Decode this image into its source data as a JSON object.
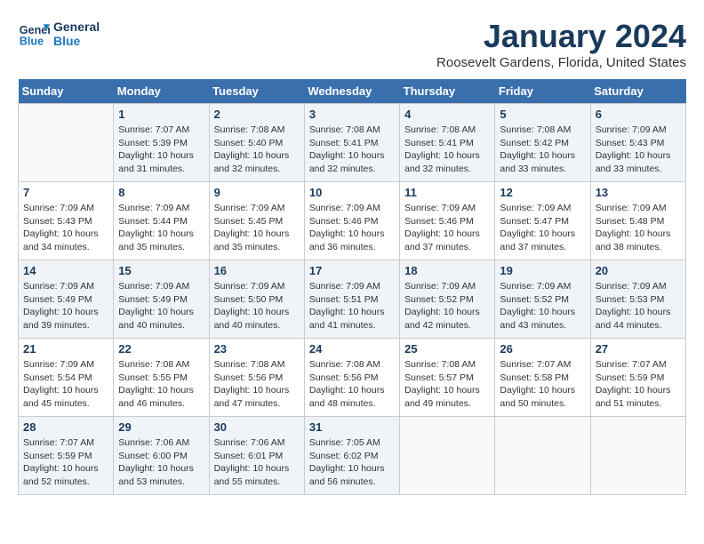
{
  "logo": {
    "line1": "General",
    "line2": "Blue"
  },
  "title": "January 2024",
  "location": "Roosevelt Gardens, Florida, United States",
  "weekdays": [
    "Sunday",
    "Monday",
    "Tuesday",
    "Wednesday",
    "Thursday",
    "Friday",
    "Saturday"
  ],
  "weeks": [
    [
      {
        "day": "",
        "info": ""
      },
      {
        "day": "1",
        "info": "Sunrise: 7:07 AM\nSunset: 5:39 PM\nDaylight: 10 hours\nand 31 minutes."
      },
      {
        "day": "2",
        "info": "Sunrise: 7:08 AM\nSunset: 5:40 PM\nDaylight: 10 hours\nand 32 minutes."
      },
      {
        "day": "3",
        "info": "Sunrise: 7:08 AM\nSunset: 5:41 PM\nDaylight: 10 hours\nand 32 minutes."
      },
      {
        "day": "4",
        "info": "Sunrise: 7:08 AM\nSunset: 5:41 PM\nDaylight: 10 hours\nand 32 minutes."
      },
      {
        "day": "5",
        "info": "Sunrise: 7:08 AM\nSunset: 5:42 PM\nDaylight: 10 hours\nand 33 minutes."
      },
      {
        "day": "6",
        "info": "Sunrise: 7:09 AM\nSunset: 5:43 PM\nDaylight: 10 hours\nand 33 minutes."
      }
    ],
    [
      {
        "day": "7",
        "info": "Sunrise: 7:09 AM\nSunset: 5:43 PM\nDaylight: 10 hours\nand 34 minutes."
      },
      {
        "day": "8",
        "info": "Sunrise: 7:09 AM\nSunset: 5:44 PM\nDaylight: 10 hours\nand 35 minutes."
      },
      {
        "day": "9",
        "info": "Sunrise: 7:09 AM\nSunset: 5:45 PM\nDaylight: 10 hours\nand 35 minutes."
      },
      {
        "day": "10",
        "info": "Sunrise: 7:09 AM\nSunset: 5:46 PM\nDaylight: 10 hours\nand 36 minutes."
      },
      {
        "day": "11",
        "info": "Sunrise: 7:09 AM\nSunset: 5:46 PM\nDaylight: 10 hours\nand 37 minutes."
      },
      {
        "day": "12",
        "info": "Sunrise: 7:09 AM\nSunset: 5:47 PM\nDaylight: 10 hours\nand 37 minutes."
      },
      {
        "day": "13",
        "info": "Sunrise: 7:09 AM\nSunset: 5:48 PM\nDaylight: 10 hours\nand 38 minutes."
      }
    ],
    [
      {
        "day": "14",
        "info": "Sunrise: 7:09 AM\nSunset: 5:49 PM\nDaylight: 10 hours\nand 39 minutes."
      },
      {
        "day": "15",
        "info": "Sunrise: 7:09 AM\nSunset: 5:49 PM\nDaylight: 10 hours\nand 40 minutes."
      },
      {
        "day": "16",
        "info": "Sunrise: 7:09 AM\nSunset: 5:50 PM\nDaylight: 10 hours\nand 40 minutes."
      },
      {
        "day": "17",
        "info": "Sunrise: 7:09 AM\nSunset: 5:51 PM\nDaylight: 10 hours\nand 41 minutes."
      },
      {
        "day": "18",
        "info": "Sunrise: 7:09 AM\nSunset: 5:52 PM\nDaylight: 10 hours\nand 42 minutes."
      },
      {
        "day": "19",
        "info": "Sunrise: 7:09 AM\nSunset: 5:52 PM\nDaylight: 10 hours\nand 43 minutes."
      },
      {
        "day": "20",
        "info": "Sunrise: 7:09 AM\nSunset: 5:53 PM\nDaylight: 10 hours\nand 44 minutes."
      }
    ],
    [
      {
        "day": "21",
        "info": "Sunrise: 7:09 AM\nSunset: 5:54 PM\nDaylight: 10 hours\nand 45 minutes."
      },
      {
        "day": "22",
        "info": "Sunrise: 7:08 AM\nSunset: 5:55 PM\nDaylight: 10 hours\nand 46 minutes."
      },
      {
        "day": "23",
        "info": "Sunrise: 7:08 AM\nSunset: 5:56 PM\nDaylight: 10 hours\nand 47 minutes."
      },
      {
        "day": "24",
        "info": "Sunrise: 7:08 AM\nSunset: 5:56 PM\nDaylight: 10 hours\nand 48 minutes."
      },
      {
        "day": "25",
        "info": "Sunrise: 7:08 AM\nSunset: 5:57 PM\nDaylight: 10 hours\nand 49 minutes."
      },
      {
        "day": "26",
        "info": "Sunrise: 7:07 AM\nSunset: 5:58 PM\nDaylight: 10 hours\nand 50 minutes."
      },
      {
        "day": "27",
        "info": "Sunrise: 7:07 AM\nSunset: 5:59 PM\nDaylight: 10 hours\nand 51 minutes."
      }
    ],
    [
      {
        "day": "28",
        "info": "Sunrise: 7:07 AM\nSunset: 5:59 PM\nDaylight: 10 hours\nand 52 minutes."
      },
      {
        "day": "29",
        "info": "Sunrise: 7:06 AM\nSunset: 6:00 PM\nDaylight: 10 hours\nand 53 minutes."
      },
      {
        "day": "30",
        "info": "Sunrise: 7:06 AM\nSunset: 6:01 PM\nDaylight: 10 hours\nand 55 minutes."
      },
      {
        "day": "31",
        "info": "Sunrise: 7:05 AM\nSunset: 6:02 PM\nDaylight: 10 hours\nand 56 minutes."
      },
      {
        "day": "",
        "info": ""
      },
      {
        "day": "",
        "info": ""
      },
      {
        "day": "",
        "info": ""
      }
    ]
  ]
}
